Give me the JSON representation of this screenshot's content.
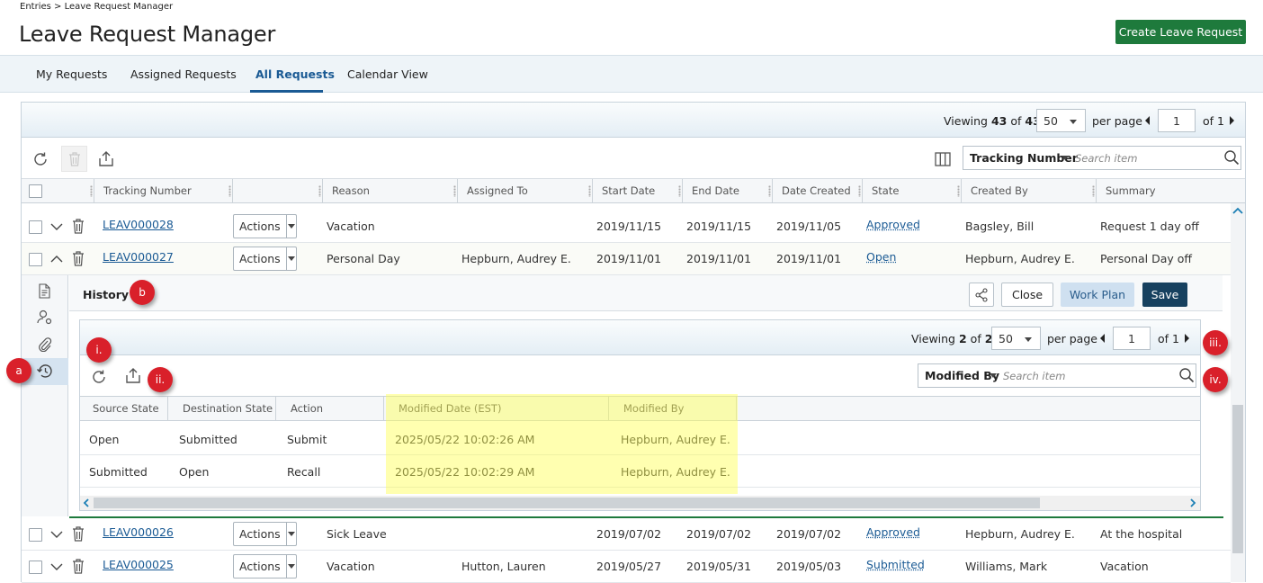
{
  "breadcrumb": "Entries > Leave Request Manager",
  "page_title": "Leave Request Manager",
  "create_button": "Create Leave Request",
  "tabs": [
    {
      "label": "My Requests"
    },
    {
      "label": "Assigned Requests"
    },
    {
      "label": "All Requests",
      "active": true
    },
    {
      "label": "Calendar View"
    }
  ],
  "grid": {
    "viewing_label": "Viewing",
    "viewing_count": "43",
    "of_label": "of",
    "total": "43",
    "per_page_value": "50",
    "per_page_label": "per page",
    "page_value": "1",
    "page_of": "of 1",
    "search_field": "Tracking Number",
    "search_placeholder": "Search item",
    "columns": [
      "Tracking Number",
      "",
      "Reason",
      "Assigned To",
      "Start Date",
      "End Date",
      "Date Created",
      "State",
      "Created By",
      "Summary"
    ],
    "actions_label": "Actions",
    "rows": [
      {
        "tracking": "LEAV000028",
        "reason": "Vacation",
        "assigned": "",
        "start": "2019/11/15",
        "end": "2019/11/15",
        "created": "2019/11/05",
        "state": "Approved",
        "created_by": "Bagsley, Bill",
        "summary": "Request 1 day off"
      },
      {
        "tracking": "LEAV000027",
        "reason": "Personal Day",
        "assigned": "Hepburn, Audrey E.",
        "start": "2019/11/01",
        "end": "2019/11/01",
        "created": "2019/11/01",
        "state": "Open",
        "created_by": "Hepburn, Audrey E.",
        "summary": "Personal Day off"
      },
      {
        "tracking": "LEAV000026",
        "reason": "Sick Leave",
        "assigned": "",
        "start": "2019/07/02",
        "end": "2019/07/02",
        "created": "2019/07/02",
        "state": "Approved",
        "created_by": "Hepburn, Audrey E.",
        "summary": "At the hospital"
      },
      {
        "tracking": "LEAV000025",
        "reason": "Vacation",
        "assigned": "Hutton, Lauren",
        "start": "2019/05/27",
        "end": "2019/05/31",
        "created": "2019/05/03",
        "state": "Submitted",
        "created_by": "Williams, Mark",
        "summary": "Vacation"
      }
    ]
  },
  "detail": {
    "title": "History",
    "close": "Close",
    "work_plan": "Work Plan",
    "save": "Save"
  },
  "history": {
    "viewing_label": "Viewing",
    "viewing_count": "2",
    "of_label": "of",
    "total": "2",
    "per_page_value": "50",
    "per_page_label": "per page",
    "page_value": "1",
    "page_of": "of 1",
    "search_field": "Modified By",
    "search_placeholder": "Search item",
    "columns": [
      "Source State",
      "Destination State",
      "Action",
      "Modified Date (EST)",
      "Modified By"
    ],
    "rows": [
      {
        "source": "Open",
        "dest": "Submitted",
        "action": "Submit",
        "date": "2025/05/22 10:02:26 AM",
        "by": "Hepburn, Audrey E."
      },
      {
        "source": "Submitted",
        "dest": "Open",
        "action": "Recall",
        "date": "2025/05/22 10:02:29 AM",
        "by": "Hepburn, Audrey E."
      }
    ]
  },
  "callouts": {
    "a": "a",
    "b": "b",
    "i": "i.",
    "ii": "ii.",
    "iii": "iii.",
    "iv": "iv."
  },
  "colors": {
    "accent": "#1a5a94",
    "create": "#1e7a3c",
    "save": "#17415f",
    "callout": "#d9202a",
    "highlight": "#ffff50"
  },
  "icons": [
    "refresh-icon",
    "trash-icon",
    "export-icon",
    "columns-icon",
    "search-icon",
    "chevron-down-icon",
    "chevron-up-icon",
    "document-icon",
    "user-settings-icon",
    "paperclip-icon",
    "history-icon",
    "share-icon"
  ]
}
